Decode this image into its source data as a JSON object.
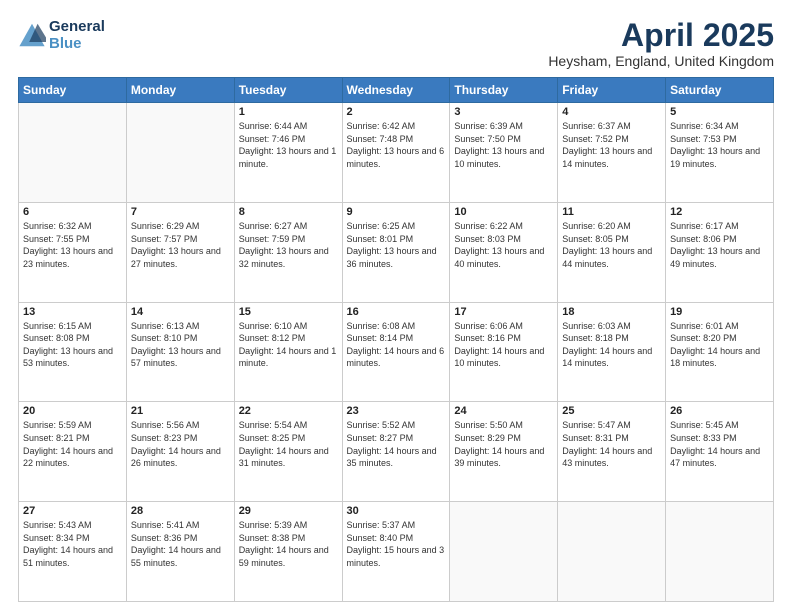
{
  "header": {
    "logo_line1": "General",
    "logo_line2": "Blue",
    "title": "April 2025",
    "subtitle": "Heysham, England, United Kingdom"
  },
  "weekdays": [
    "Sunday",
    "Monday",
    "Tuesday",
    "Wednesday",
    "Thursday",
    "Friday",
    "Saturday"
  ],
  "weeks": [
    [
      {
        "day": "",
        "info": ""
      },
      {
        "day": "",
        "info": ""
      },
      {
        "day": "1",
        "info": "Sunrise: 6:44 AM\nSunset: 7:46 PM\nDaylight: 13 hours and 1 minute."
      },
      {
        "day": "2",
        "info": "Sunrise: 6:42 AM\nSunset: 7:48 PM\nDaylight: 13 hours and 6 minutes."
      },
      {
        "day": "3",
        "info": "Sunrise: 6:39 AM\nSunset: 7:50 PM\nDaylight: 13 hours and 10 minutes."
      },
      {
        "day": "4",
        "info": "Sunrise: 6:37 AM\nSunset: 7:52 PM\nDaylight: 13 hours and 14 minutes."
      },
      {
        "day": "5",
        "info": "Sunrise: 6:34 AM\nSunset: 7:53 PM\nDaylight: 13 hours and 19 minutes."
      }
    ],
    [
      {
        "day": "6",
        "info": "Sunrise: 6:32 AM\nSunset: 7:55 PM\nDaylight: 13 hours and 23 minutes."
      },
      {
        "day": "7",
        "info": "Sunrise: 6:29 AM\nSunset: 7:57 PM\nDaylight: 13 hours and 27 minutes."
      },
      {
        "day": "8",
        "info": "Sunrise: 6:27 AM\nSunset: 7:59 PM\nDaylight: 13 hours and 32 minutes."
      },
      {
        "day": "9",
        "info": "Sunrise: 6:25 AM\nSunset: 8:01 PM\nDaylight: 13 hours and 36 minutes."
      },
      {
        "day": "10",
        "info": "Sunrise: 6:22 AM\nSunset: 8:03 PM\nDaylight: 13 hours and 40 minutes."
      },
      {
        "day": "11",
        "info": "Sunrise: 6:20 AM\nSunset: 8:05 PM\nDaylight: 13 hours and 44 minutes."
      },
      {
        "day": "12",
        "info": "Sunrise: 6:17 AM\nSunset: 8:06 PM\nDaylight: 13 hours and 49 minutes."
      }
    ],
    [
      {
        "day": "13",
        "info": "Sunrise: 6:15 AM\nSunset: 8:08 PM\nDaylight: 13 hours and 53 minutes."
      },
      {
        "day": "14",
        "info": "Sunrise: 6:13 AM\nSunset: 8:10 PM\nDaylight: 13 hours and 57 minutes."
      },
      {
        "day": "15",
        "info": "Sunrise: 6:10 AM\nSunset: 8:12 PM\nDaylight: 14 hours and 1 minute."
      },
      {
        "day": "16",
        "info": "Sunrise: 6:08 AM\nSunset: 8:14 PM\nDaylight: 14 hours and 6 minutes."
      },
      {
        "day": "17",
        "info": "Sunrise: 6:06 AM\nSunset: 8:16 PM\nDaylight: 14 hours and 10 minutes."
      },
      {
        "day": "18",
        "info": "Sunrise: 6:03 AM\nSunset: 8:18 PM\nDaylight: 14 hours and 14 minutes."
      },
      {
        "day": "19",
        "info": "Sunrise: 6:01 AM\nSunset: 8:20 PM\nDaylight: 14 hours and 18 minutes."
      }
    ],
    [
      {
        "day": "20",
        "info": "Sunrise: 5:59 AM\nSunset: 8:21 PM\nDaylight: 14 hours and 22 minutes."
      },
      {
        "day": "21",
        "info": "Sunrise: 5:56 AM\nSunset: 8:23 PM\nDaylight: 14 hours and 26 minutes."
      },
      {
        "day": "22",
        "info": "Sunrise: 5:54 AM\nSunset: 8:25 PM\nDaylight: 14 hours and 31 minutes."
      },
      {
        "day": "23",
        "info": "Sunrise: 5:52 AM\nSunset: 8:27 PM\nDaylight: 14 hours and 35 minutes."
      },
      {
        "day": "24",
        "info": "Sunrise: 5:50 AM\nSunset: 8:29 PM\nDaylight: 14 hours and 39 minutes."
      },
      {
        "day": "25",
        "info": "Sunrise: 5:47 AM\nSunset: 8:31 PM\nDaylight: 14 hours and 43 minutes."
      },
      {
        "day": "26",
        "info": "Sunrise: 5:45 AM\nSunset: 8:33 PM\nDaylight: 14 hours and 47 minutes."
      }
    ],
    [
      {
        "day": "27",
        "info": "Sunrise: 5:43 AM\nSunset: 8:34 PM\nDaylight: 14 hours and 51 minutes."
      },
      {
        "day": "28",
        "info": "Sunrise: 5:41 AM\nSunset: 8:36 PM\nDaylight: 14 hours and 55 minutes."
      },
      {
        "day": "29",
        "info": "Sunrise: 5:39 AM\nSunset: 8:38 PM\nDaylight: 14 hours and 59 minutes."
      },
      {
        "day": "30",
        "info": "Sunrise: 5:37 AM\nSunset: 8:40 PM\nDaylight: 15 hours and 3 minutes."
      },
      {
        "day": "",
        "info": ""
      },
      {
        "day": "",
        "info": ""
      },
      {
        "day": "",
        "info": ""
      }
    ]
  ]
}
